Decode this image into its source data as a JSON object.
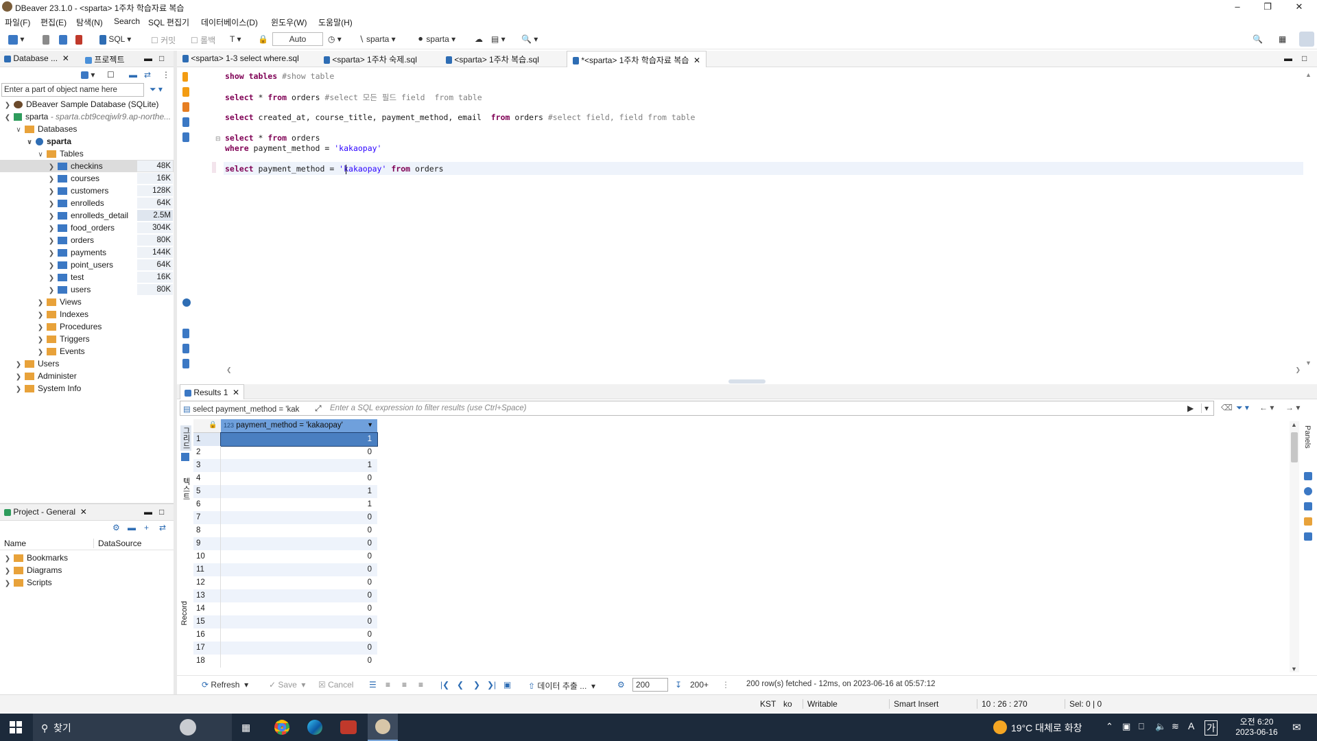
{
  "window": {
    "title": "DBeaver 23.1.0 - <sparta> 1주차 학습자료 복습"
  },
  "menu": [
    "파일(F)",
    "편집(E)",
    "탐색(N)",
    "Search",
    "SQL 편집기",
    "데이터베이스(D)",
    "윈도우(W)",
    "도움말(H)"
  ],
  "toolbar": {
    "sql_label": "SQL",
    "commit_label": "커밋",
    "rollback_label": "롤백",
    "auto_label": "Auto",
    "schema1": "sparta",
    "schema2": "sparta"
  },
  "nav_panel": {
    "tab_db": "Database ...",
    "tab_project": "프로젝트",
    "filter_placeholder": "Enter a part of object name here",
    "sample_db": "DBeaver Sample Database (SQLite)",
    "conn_name": "sparta",
    "conn_host": "- sparta.cbt9ceqjwlr9.ap-northe...",
    "databases": "Databases",
    "schema": "sparta",
    "tables_folder": "Tables",
    "tables": [
      {
        "name": "checkins",
        "size": "48K"
      },
      {
        "name": "courses",
        "size": "16K"
      },
      {
        "name": "customers",
        "size": "128K"
      },
      {
        "name": "enrolleds",
        "size": "64K"
      },
      {
        "name": "enrolleds_detail",
        "size": "2.5M"
      },
      {
        "name": "food_orders",
        "size": "304K"
      },
      {
        "name": "orders",
        "size": "80K"
      },
      {
        "name": "payments",
        "size": "144K"
      },
      {
        "name": "point_users",
        "size": "64K"
      },
      {
        "name": "test",
        "size": "16K"
      },
      {
        "name": "users",
        "size": "80K"
      }
    ],
    "folders": [
      "Views",
      "Indexes",
      "Procedures",
      "Triggers",
      "Events"
    ],
    "root_folders": [
      "Users",
      "Administer",
      "System Info"
    ]
  },
  "project_panel": {
    "tab": "Project - General",
    "col_name": "Name",
    "col_ds": "DataSource",
    "items": [
      "Bookmarks",
      "Diagrams",
      "Scripts"
    ]
  },
  "editor_tabs": [
    {
      "label": "<sparta> 1-3 select where.sql"
    },
    {
      "label": "<sparta> 1주차 숙제.sql"
    },
    {
      "label": "<sparta> 1주차 복습.sql"
    },
    {
      "label": "*<sparta> 1주차 학습자료 복습"
    }
  ],
  "code": {
    "l1_kw": "show tables",
    "l1_cm": "#show table",
    "l2_a": "select",
    "l2_b": " * ",
    "l2_c": "from",
    "l2_d": " orders ",
    "l2_cm": "#select 모든 필드 field  from table",
    "l3_a": "select",
    "l3_b": " created_at, course_title, payment_method, email  ",
    "l3_c": "from",
    "l3_d": " orders ",
    "l3_cm": "#select field, field from table",
    "l4_a": "select",
    "l4_b": " * ",
    "l4_c": "from",
    "l4_d": " orders",
    "l5_a": "where",
    "l5_b": " payment_method = ",
    "l5_s": "'kakaopay'",
    "l6_a": "select",
    "l6_b": " payment_method = ",
    "l6_s": "'kakaopay'",
    "l6_c": " from",
    "l6_d": " orders"
  },
  "results": {
    "tab": "Results 1",
    "query_preview": "select payment_method = 'kak",
    "filter_placeholder": "Enter a SQL expression to filter results (use Ctrl+Space)",
    "column": "payment_method = 'kakaopay'",
    "col_type": "123",
    "rows": [
      {
        "n": "1",
        "v": "1"
      },
      {
        "n": "2",
        "v": "0"
      },
      {
        "n": "3",
        "v": "1"
      },
      {
        "n": "4",
        "v": "0"
      },
      {
        "n": "5",
        "v": "1"
      },
      {
        "n": "6",
        "v": "1"
      },
      {
        "n": "7",
        "v": "0"
      },
      {
        "n": "8",
        "v": "0"
      },
      {
        "n": "9",
        "v": "0"
      },
      {
        "n": "10",
        "v": "0"
      },
      {
        "n": "11",
        "v": "0"
      },
      {
        "n": "12",
        "v": "0"
      },
      {
        "n": "13",
        "v": "0"
      },
      {
        "n": "14",
        "v": "0"
      },
      {
        "n": "15",
        "v": "0"
      },
      {
        "n": "16",
        "v": "0"
      },
      {
        "n": "17",
        "v": "0"
      },
      {
        "n": "18",
        "v": "0"
      }
    ],
    "refresh": "Refresh",
    "save": "Save",
    "cancel": "Cancel",
    "export": "데이터 추출 ...",
    "fetch_size": "200",
    "fetch_more": "200+",
    "status": "200 row(s) fetched - 12ms, on 2023-06-16 at 05:57:12",
    "side_grid": "그리드",
    "side_text": "텍스트",
    "side_record": "Record",
    "side_panels": "Panels"
  },
  "statusbar": {
    "tz": "KST",
    "lang": "ko",
    "mode": "Writable",
    "insert": "Smart Insert",
    "pos": "10 : 26 : 270",
    "sel": "Sel: 0 | 0"
  },
  "taskbar": {
    "search": "찾기",
    "weather": "19°C  대체로 화창",
    "ime": "A",
    "ime2": "가",
    "time": "오전 6:20",
    "date": "2023-06-16"
  }
}
